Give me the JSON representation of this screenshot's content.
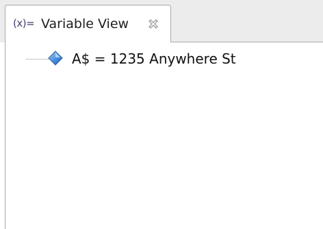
{
  "view": {
    "tab": {
      "icon_label": "(x)=",
      "title": "Variable View",
      "icon": "variables-view-icon",
      "close_icon": "close-icon"
    },
    "variables": [
      {
        "text": "A$ = 1235 Anywhere St",
        "icon": "variable-diamond-icon"
      }
    ]
  },
  "colors": {
    "tab_strip": "#ececec",
    "border": "#a8a8a8",
    "diamond_light": "#6fb0f0",
    "diamond_dark": "#1f5fb8"
  }
}
